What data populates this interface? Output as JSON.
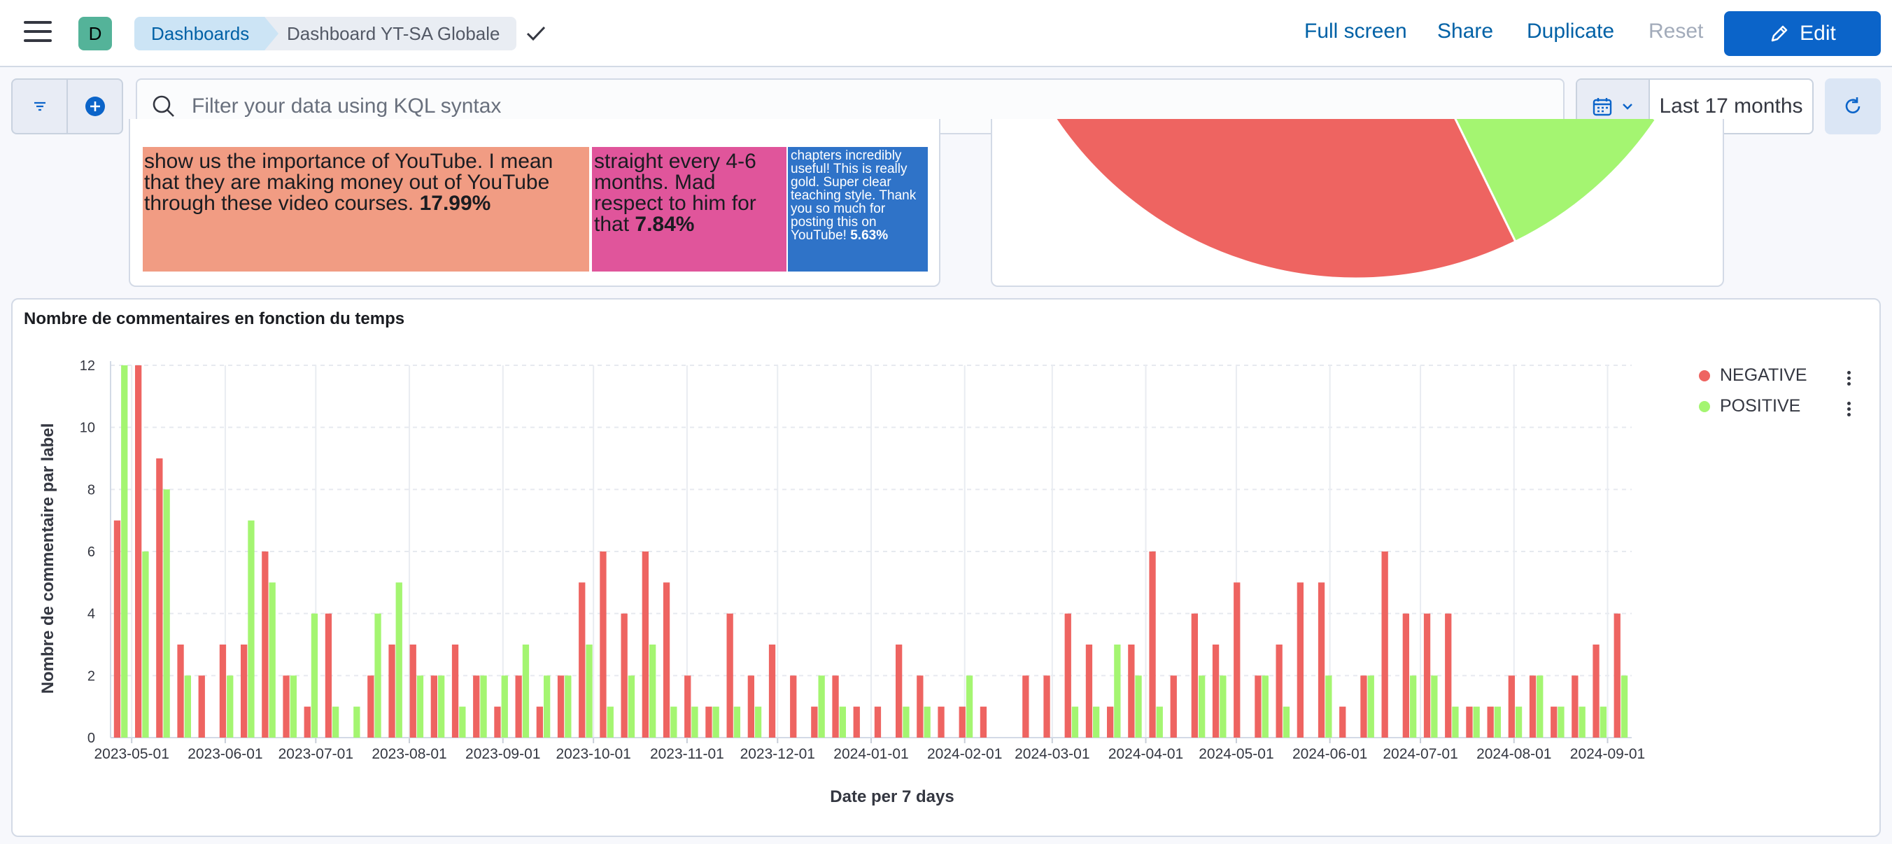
{
  "header": {
    "space_initial": "D",
    "breadcrumb": [
      "Dashboards",
      "Dashboard YT-SA Globale"
    ],
    "actions": [
      "Full screen",
      "Share",
      "Duplicate",
      "Reset"
    ],
    "edit_label": "Edit"
  },
  "querybar": {
    "placeholder": "Filter your data using KQL syntax",
    "date_range": "Last 17 months"
  },
  "treemap": {
    "cells": [
      {
        "text": "show us the importance of YouTube. I mean that they are making money out of YouTube through these video courses.",
        "pct": "17.99%",
        "color": "#f19c83"
      },
      {
        "text": "straight every 4-6 months. Mad respect to him for that",
        "pct": "7.84%",
        "color": "#e0559b"
      },
      {
        "text": "chapters incredibly useful! This is really gold. Super clear teaching style. Thank you so much for posting this on YouTube!",
        "pct": "5.63%",
        "color": "#2f73c8"
      }
    ]
  },
  "pie": {
    "colors": {
      "negative": "#ee6461",
      "positive": "#a4f571"
    }
  },
  "chart_data": {
    "type": "bar",
    "title": "Nombre de commentaires en fonction du temps",
    "xlabel": "Date per 7 days",
    "ylabel": "Nombre de commentaire par label",
    "ylim": [
      0,
      12
    ],
    "yticks": [
      0,
      2,
      4,
      6,
      8,
      10,
      12
    ],
    "xticks": [
      "2023-05-01",
      "2023-06-01",
      "2023-07-01",
      "2023-08-01",
      "2023-09-01",
      "2023-10-01",
      "2023-11-01",
      "2023-12-01",
      "2024-01-01",
      "2024-02-01",
      "2024-03-01",
      "2024-04-01",
      "2024-05-01",
      "2024-06-01",
      "2024-07-01",
      "2024-08-01",
      "2024-09-01"
    ],
    "categories": [
      "2023-04-24",
      "2023-05-01",
      "2023-05-08",
      "2023-05-15",
      "2023-05-22",
      "2023-05-29",
      "2023-06-05",
      "2023-06-12",
      "2023-06-19",
      "2023-06-26",
      "2023-07-03",
      "2023-07-10",
      "2023-07-17",
      "2023-07-24",
      "2023-07-31",
      "2023-08-07",
      "2023-08-14",
      "2023-08-21",
      "2023-08-28",
      "2023-09-04",
      "2023-09-11",
      "2023-09-18",
      "2023-09-25",
      "2023-10-02",
      "2023-10-09",
      "2023-10-16",
      "2023-10-23",
      "2023-10-30",
      "2023-11-06",
      "2023-11-13",
      "2023-11-20",
      "2023-11-27",
      "2023-12-04",
      "2023-12-11",
      "2023-12-18",
      "2023-12-25",
      "2024-01-01",
      "2024-01-08",
      "2024-01-15",
      "2024-01-22",
      "2024-01-29",
      "2024-02-05",
      "2024-02-12",
      "2024-02-19",
      "2024-02-26",
      "2024-03-04",
      "2024-03-11",
      "2024-03-18",
      "2024-03-25",
      "2024-04-01",
      "2024-04-08",
      "2024-04-15",
      "2024-04-22",
      "2024-04-29",
      "2024-05-06",
      "2024-05-13",
      "2024-05-20",
      "2024-05-27",
      "2024-06-03",
      "2024-06-10",
      "2024-06-17",
      "2024-06-24",
      "2024-07-01",
      "2024-07-08",
      "2024-07-15",
      "2024-07-22",
      "2024-07-29",
      "2024-08-05",
      "2024-08-12",
      "2024-08-19",
      "2024-08-26",
      "2024-09-02"
    ],
    "series": [
      {
        "name": "NEGATIVE",
        "color": "#ee6461",
        "values": [
          7,
          12,
          9,
          3,
          2,
          3,
          3,
          6,
          2,
          1,
          4,
          0,
          2,
          3,
          3,
          2,
          3,
          2,
          1,
          2,
          1,
          2,
          5,
          6,
          4,
          6,
          5,
          2,
          1,
          4,
          2,
          3,
          2,
          1,
          2,
          1,
          1,
          3,
          2,
          1,
          1,
          1,
          0,
          2,
          2,
          4,
          3,
          1,
          3,
          6,
          2,
          4,
          3,
          5,
          2,
          3,
          5,
          5,
          1,
          2,
          6,
          4,
          4,
          4,
          1,
          1,
          2,
          2,
          1,
          2,
          3,
          4
        ]
      },
      {
        "name": "POSITIVE",
        "color": "#a4f571",
        "values": [
          12,
          6,
          8,
          2,
          0,
          2,
          7,
          5,
          2,
          4,
          1,
          1,
          4,
          5,
          2,
          2,
          1,
          2,
          2,
          3,
          2,
          2,
          3,
          1,
          2,
          3,
          1,
          1,
          1,
          1,
          1,
          0,
          0,
          2,
          1,
          0,
          0,
          1,
          1,
          0,
          2,
          0,
          0,
          0,
          0,
          1,
          1,
          3,
          2,
          1,
          0,
          2,
          2,
          0,
          2,
          1,
          0,
          2,
          0,
          2,
          0,
          2,
          2,
          1,
          1,
          1,
          1,
          2,
          1,
          1,
          1,
          2
        ]
      }
    ],
    "legend_position": "top-right",
    "grid": true
  }
}
